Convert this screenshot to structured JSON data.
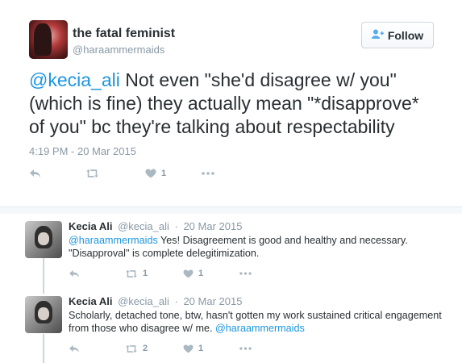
{
  "main_tweet": {
    "author_name": "the fatal feminist",
    "author_handle": "@haraammermaids",
    "follow_label": "Follow",
    "text_mention": "@kecia_ali",
    "text_body": " Not even \"she'd disagree w/ you\" (which is fine) they actually mean \"*disapprove* of you\" bc they're talking about respectability",
    "timestamp": "4:19 PM - 20 Mar 2015",
    "likes": "1"
  },
  "replies": [
    {
      "author_name": "Kecia Ali",
      "author_handle": "@kecia_ali",
      "date": "20 Mar 2015",
      "text_mention": "@haraammermaids",
      "text_body": " Yes! Disagreement is good and healthy and necessary. \"Disapproval\" is complete delegitimization.",
      "retweets": "1",
      "likes": "1"
    },
    {
      "author_name": "Kecia Ali",
      "author_handle": "@kecia_ali",
      "date": "20 Mar 2015",
      "text_body": "Scholarly, detached tone, btw, hasn't gotten my work sustained critical engagement from those who disagree w/ me. ",
      "text_mention": "@haraammermaids",
      "retweets": "2",
      "likes": "1"
    }
  ],
  "icons": {
    "reply": "reply-icon",
    "retweet": "retweet-icon",
    "like": "heart-icon",
    "more": "more-icon",
    "follow": "follow-user-icon"
  },
  "colors": {
    "link": "#1b95e0",
    "secondary_text": "#8899a6",
    "action_icon": "#aab8c2"
  }
}
